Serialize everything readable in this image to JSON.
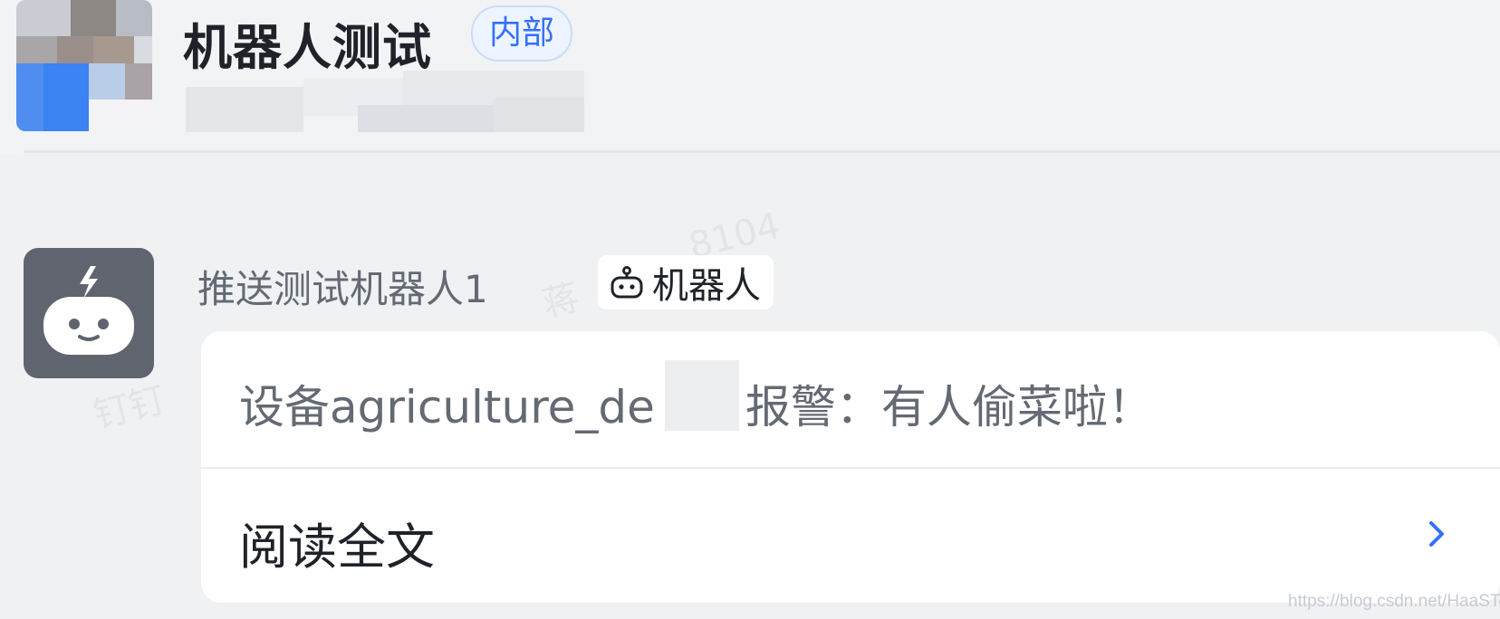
{
  "conversation": {
    "title": "机器人测试",
    "badge": "内部"
  },
  "watermark": {
    "number": "8104",
    "name_short": "蒋",
    "app": "钉钉"
  },
  "message": {
    "sender": "推送测试机器人1",
    "bot_tag": "机器人",
    "text": "设备agriculture_de　　报警：有人偷菜啦！",
    "read_more": "阅读全文"
  },
  "footer": {
    "url_watermark": "https://blog.csdn.net/HaaSTech"
  },
  "icons": {
    "bot_avatar": "robot-face-icon",
    "bot_tag": "robot-icon",
    "read_more": "chevron-right-icon"
  },
  "colors": {
    "accent": "#3370ff",
    "bot_avatar_bg": "#5f646e",
    "page_bg": "#f0f1f3",
    "card_bg": "#ffffff"
  }
}
